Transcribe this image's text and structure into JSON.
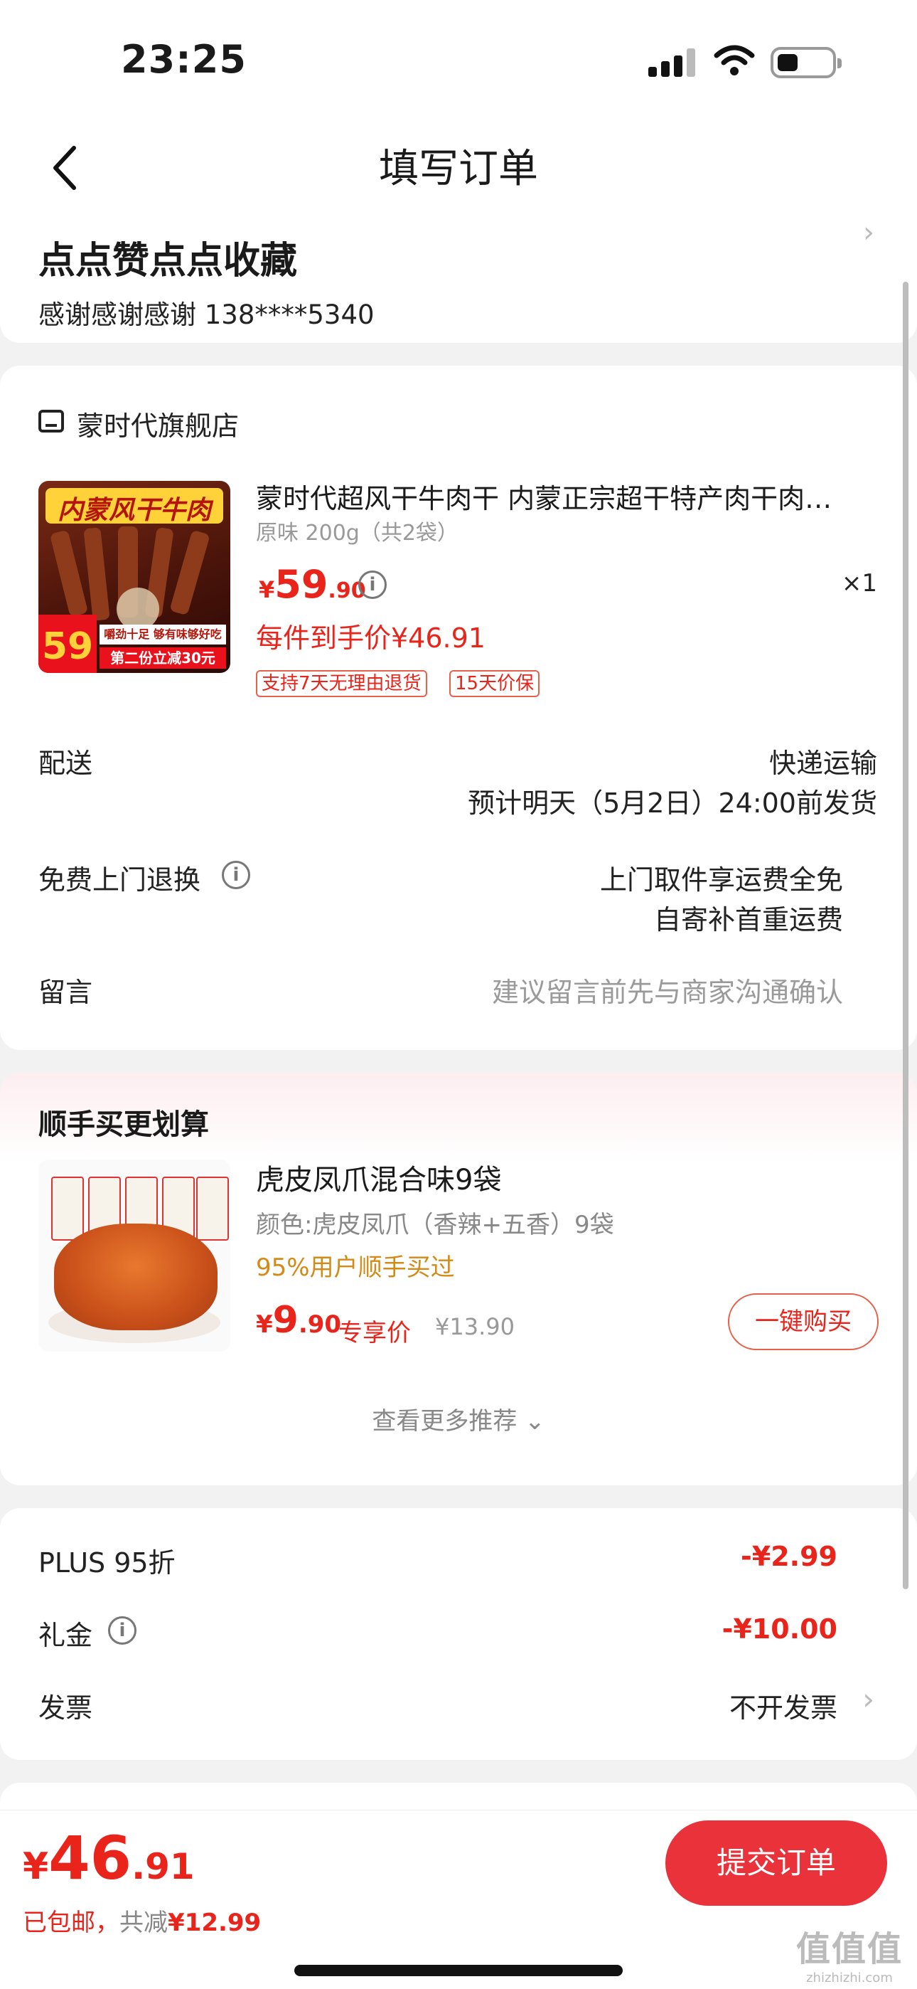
{
  "status": {
    "time": "23:25"
  },
  "nav": {
    "title": "填写订单"
  },
  "address": {
    "name": "点点赞点点收藏",
    "contact": "感谢感谢感谢  138****5340"
  },
  "store": {
    "name": "蒙时代旗舰店",
    "product": {
      "image_band": "内蒙风干牛肉",
      "image_tagline": "嚼劲十足 够有味够好吃",
      "image_price": "59",
      "image_promo": "第二份立减30元",
      "title": "蒙时代超风干牛肉干 内蒙正宗超干特产肉干肉…",
      "spec": "原味 200g（共2袋）",
      "price_currency": "¥",
      "price_int": "59",
      "price_dec": ".90",
      "qty": "×1",
      "unit_price": "每件到手价¥46.91",
      "tags": [
        "支持7天无理由退货",
        "15天价保"
      ]
    },
    "delivery": {
      "label": "配送",
      "method": "快递运输",
      "eta": "预计明天（5月2日）24:00前发货"
    },
    "returns": {
      "label": "免费上门退换",
      "line1": "上门取件享运费全免",
      "line2": "自寄补首重运费"
    },
    "message": {
      "label": "留言",
      "placeholder": "建议留言前先与商家沟通确认"
    }
  },
  "recommend": {
    "header": "顺手买更划算",
    "item": {
      "title": "虎皮凤爪混合味9袋",
      "spec": "颜色:虎皮凤爪（香辣+五香）9袋",
      "hint": "95%用户顺手买过",
      "price_currency": "¥",
      "price_int": "9",
      "price_dec": ".90",
      "exclusive": "专享价",
      "original": "¥13.90",
      "buy_label": "一键购买"
    },
    "more": "查看更多推荐 ⌄"
  },
  "summary": {
    "plus_label": "PLUS 95折",
    "plus_value": "-¥2.99",
    "gift_label": "礼金",
    "gift_value": "-¥10.00",
    "invoice_label": "发票",
    "invoice_value": "不开发票"
  },
  "bottom": {
    "currency": "¥",
    "total_int": "46",
    "total_dec": ".91",
    "free_ship": "已包邮，",
    "saved_prefix": "共减",
    "saved": "¥12.99",
    "submit": "提交订单"
  },
  "watermark": {
    "big": "值值值",
    "small": "zhizhizhi.com"
  },
  "colors": {
    "accent": "#e8241b",
    "button": "#e9323a",
    "hint": "#d48a16"
  }
}
